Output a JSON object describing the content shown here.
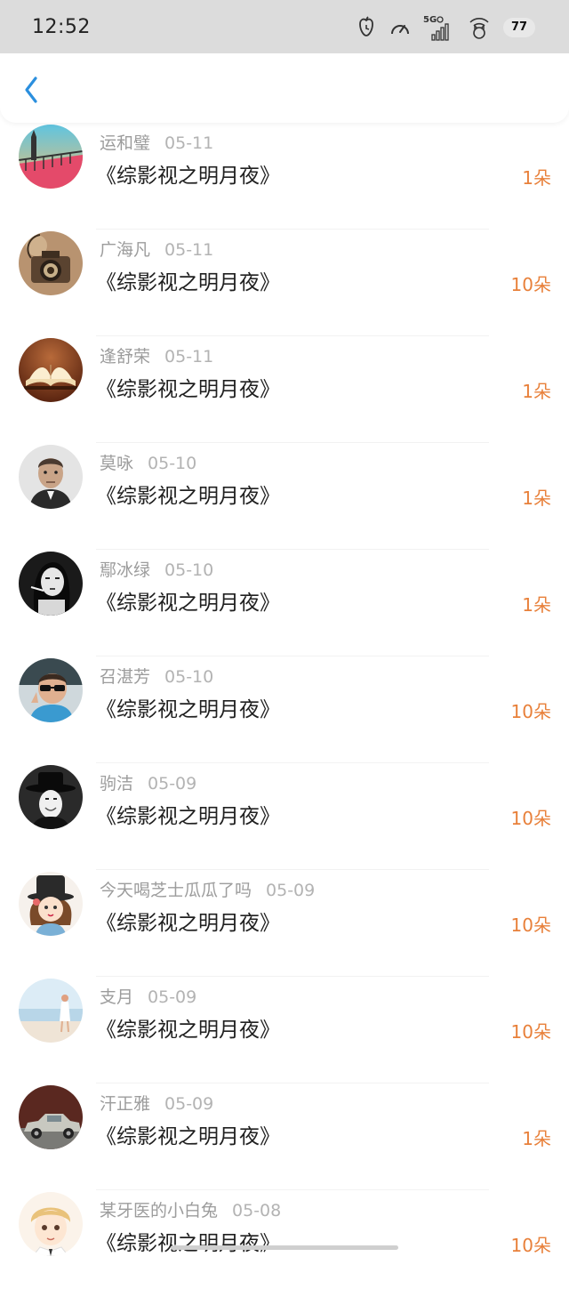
{
  "status_bar": {
    "time": "12:52",
    "network_label": "5G",
    "battery_level": "77"
  },
  "nav": {
    "back_icon": "chevron-left-icon",
    "accent_color": "#2b8fde"
  },
  "colors": {
    "count": "#e8803a",
    "name": "#9c9c9c",
    "title": "#202020"
  },
  "gifts": [
    {
      "user": "运和璧",
      "date": "05-11",
      "book": "《综影视之明月夜》",
      "count": "1朵",
      "avatar": "city-bridge"
    },
    {
      "user": "广海凡",
      "date": "05-11",
      "book": "《综影视之明月夜》",
      "count": "10朵",
      "avatar": "vintage-camera"
    },
    {
      "user": "逢舒荣",
      "date": "05-11",
      "book": "《综影视之明月夜》",
      "count": "1朵",
      "avatar": "open-book"
    },
    {
      "user": "莫咏",
      "date": "05-10",
      "book": "《综影视之明月夜》",
      "count": "1朵",
      "avatar": "man-portrait"
    },
    {
      "user": "鄢冰绿",
      "date": "05-10",
      "book": "《综影视之明月夜》",
      "count": "1朵",
      "avatar": "woman-bw"
    },
    {
      "user": "召湛芳",
      "date": "05-10",
      "book": "《综影视之明月夜》",
      "count": "10朵",
      "avatar": "kid-sunglasses"
    },
    {
      "user": "驹洁",
      "date": "05-09",
      "book": "《综影视之明月夜》",
      "count": "10朵",
      "avatar": "masked-hat"
    },
    {
      "user": "今天喝芝士瓜瓜了吗",
      "date": "05-09",
      "book": "《综影视之明月夜》",
      "count": "10朵",
      "avatar": "cartoon-girl-hat"
    },
    {
      "user": "支月",
      "date": "05-09",
      "book": "《综影视之明月夜》",
      "count": "10朵",
      "avatar": "beach-girl"
    },
    {
      "user": "汗正雅",
      "date": "05-09",
      "book": "《综影视之明月夜》",
      "count": "1朵",
      "avatar": "vintage-car"
    },
    {
      "user": "某牙医的小白兔",
      "date": "05-08",
      "book": "《综影视之明月夜》",
      "count": "10朵",
      "avatar": "cartoon-boy"
    }
  ]
}
